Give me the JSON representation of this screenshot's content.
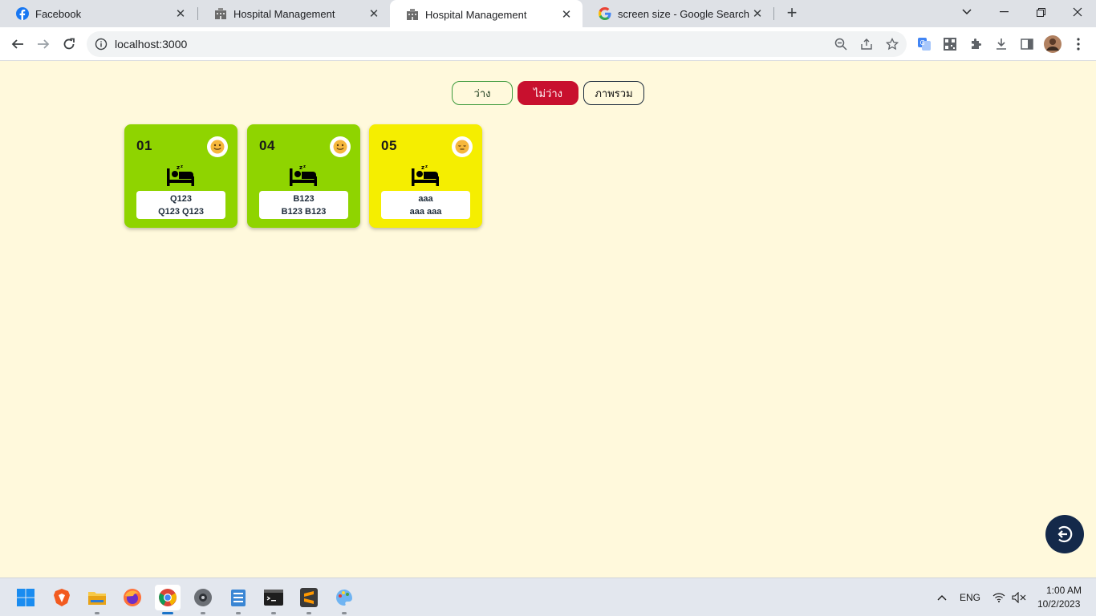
{
  "browser": {
    "tabs": [
      {
        "title": "Facebook",
        "icon": "facebook-icon"
      },
      {
        "title": "Hospital Management",
        "icon": "hospital-icon"
      },
      {
        "title": "Hospital Management",
        "icon": "hospital-icon",
        "active": true
      },
      {
        "title": "screen size - Google Search",
        "icon": "google-icon"
      }
    ],
    "url": "localhost:3000"
  },
  "filters": {
    "free_label": "ว่าง",
    "busy_label": "ไม่ว่าง",
    "overview_label": "ภาพรวม"
  },
  "beds": [
    {
      "number": "01",
      "name_line1": "Q123",
      "name_line2": "Q123 Q123",
      "status": "happy",
      "color": "#8fd400"
    },
    {
      "number": "04",
      "name_line1": "B123",
      "name_line2": "B123 B123",
      "status": "happy",
      "color": "#8fd400"
    },
    {
      "number": "05",
      "name_line1": "aaa",
      "name_line2": "aaa aaa",
      "status": "relieved",
      "color": "#f5ee00"
    }
  ],
  "taskbar": {
    "lang": "ENG",
    "time": "1:00 AM",
    "date": "10/2/2023"
  },
  "colors": {
    "page_bg": "#fff9dc",
    "busy_button": "#c8102e",
    "card_green": "#8fd400",
    "card_yellow": "#f5ee00",
    "logout_button": "#14294a"
  }
}
